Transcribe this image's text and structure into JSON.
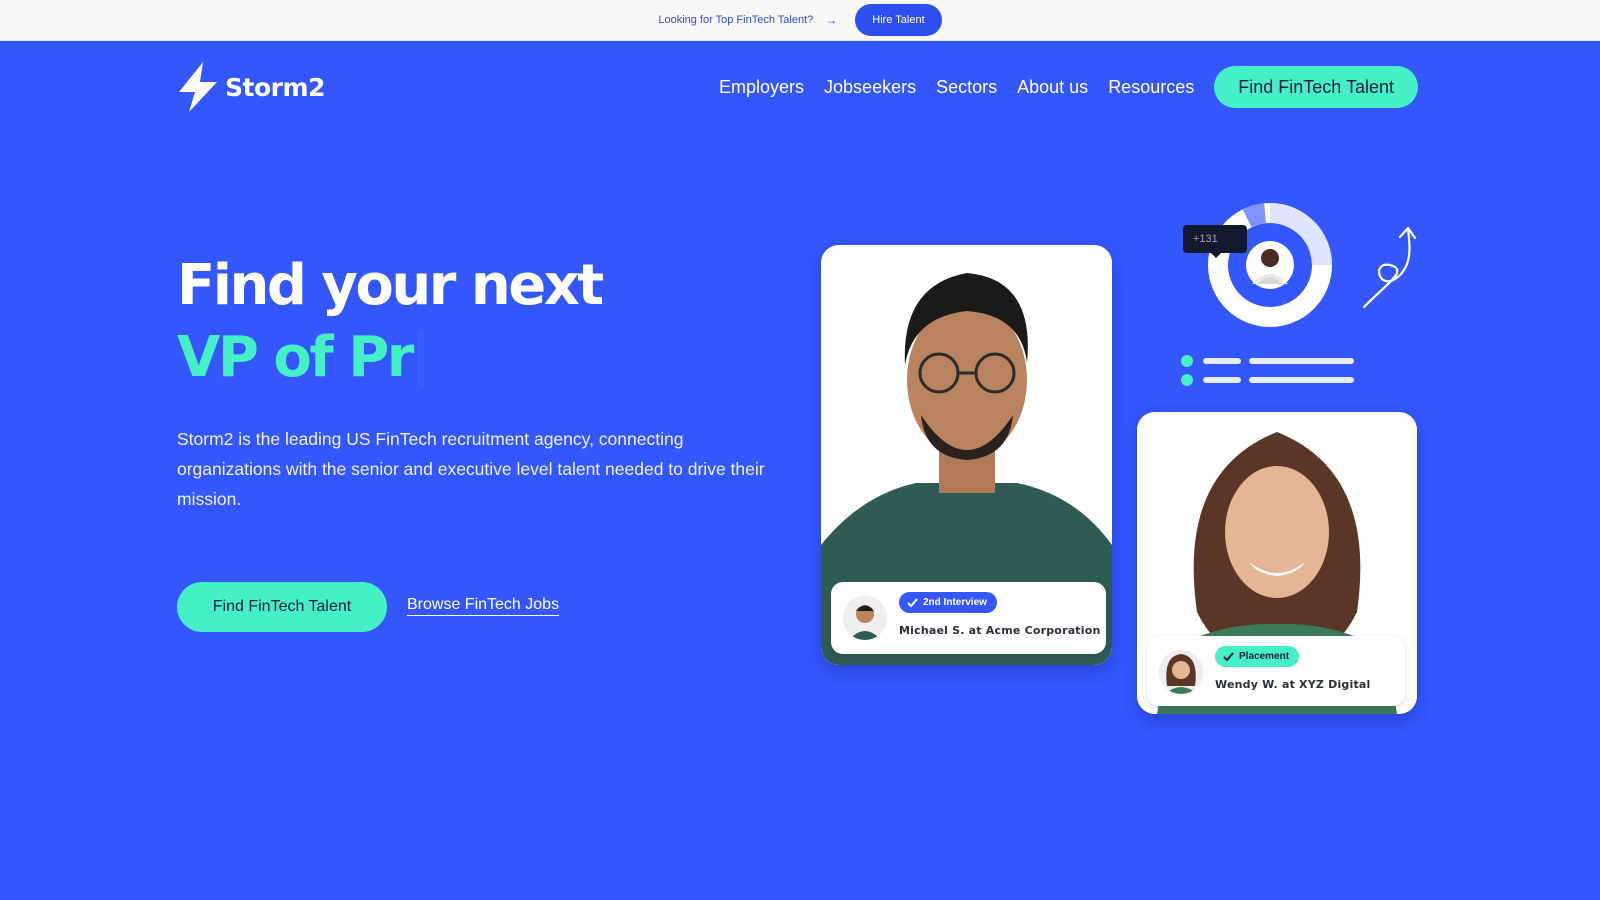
{
  "topbar": {
    "text": "Looking for Top FinTech Talent?",
    "arrow": "→",
    "button_label": "Hire Talent"
  },
  "header": {
    "logo_text": "Storm2",
    "nav": [
      "Employers",
      "Jobseekers",
      "Sectors",
      "About us",
      "Resources"
    ],
    "cta_label": "Find FinTech Talent"
  },
  "hero": {
    "title_line1": "Find your next",
    "title_line2": "VP of Pr",
    "description": "Storm2 is the leading US FinTech recruitment agency, connecting organizations with the senior and executive level talent needed to drive their mission.",
    "primary_cta": "Find FinTech Talent",
    "secondary_link": "Browse FinTech Jobs"
  },
  "cards": [
    {
      "badge": "2nd Interview",
      "name": "Michael S. at Acme Corporation",
      "badge_color": "#3356fd"
    },
    {
      "badge": "Placement",
      "name": "Wendy W. at XYZ Digital",
      "badge_color": "#45f0c6"
    }
  ],
  "decoration": {
    "tooltip_text": "+131"
  },
  "colors": {
    "brand_blue": "#3356fd",
    "accent_mint": "#45f0c6",
    "dark_text": "#0f1f3d"
  },
  "icons": [
    "lightning-bolt-icon",
    "arrow-right-icon",
    "check-icon",
    "curly-arrow-icon"
  ]
}
